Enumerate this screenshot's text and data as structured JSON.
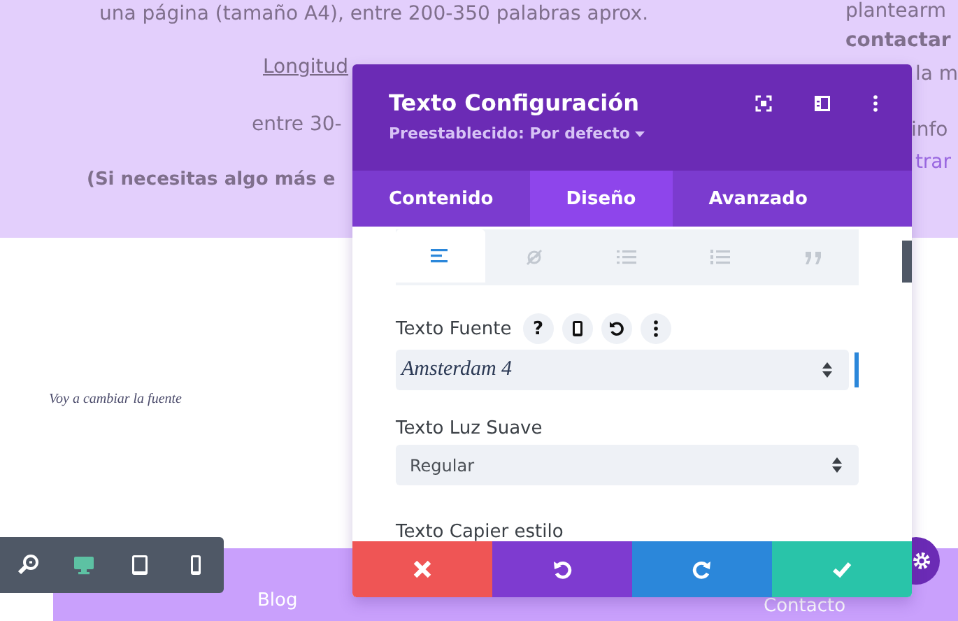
{
  "page": {
    "left_lines": [
      {
        "text": "una página (tamaño A4), entre 200-350 palabras aprox.",
        "kind": "plain"
      },
      {
        "text": "Longitud",
        "kind": "link"
      },
      {
        "text": "entre 30-",
        "kind": "plain"
      },
      {
        "text": "(Si necesitas algo más e",
        "kind": "bold"
      }
    ],
    "right_lines": [
      {
        "text": "plantearm",
        "kind": "plain"
      },
      {
        "text": "contactar",
        "kind": "bold"
      },
      {
        "text": "la m",
        "kind": "plain"
      },
      {
        "text": "info",
        "kind": "plain"
      },
      {
        "text": "trar",
        "kind": "faint"
      }
    ],
    "script_text": "Voy a cambiar la fuente"
  },
  "view_toolbar": [
    {
      "kind": "zoom",
      "selected": false
    },
    {
      "kind": "desktop",
      "selected": true
    },
    {
      "kind": "tablet",
      "selected": false
    },
    {
      "kind": "phone",
      "selected": false
    }
  ],
  "nav": [
    "Blog",
    "Contacto"
  ],
  "modal": {
    "title": "Texto Configuración",
    "preset": "Preestablecido: Por defecto",
    "tabs": [
      {
        "label": "Contenido",
        "selected": false
      },
      {
        "label": "Diseño",
        "selected": true
      },
      {
        "label": "Avanzado",
        "selected": false
      }
    ],
    "format_tabs": [
      {
        "kind": "align",
        "selected": true
      },
      {
        "kind": "link",
        "selected": false
      },
      {
        "kind": "bullets",
        "selected": false
      },
      {
        "kind": "numbers",
        "selected": false
      },
      {
        "kind": "quote",
        "selected": false
      }
    ],
    "fields": [
      {
        "label": "Texto Fuente",
        "kind": "font",
        "value": "Amsterdam 4",
        "tools": [
          {
            "kind": "help",
            "label": "?"
          },
          {
            "kind": "phone"
          },
          {
            "kind": "reset"
          },
          {
            "kind": "more"
          }
        ]
      },
      {
        "label": "Texto Luz Suave",
        "kind": "select",
        "value": "Regular"
      },
      {
        "label": "Texto Capier estilo",
        "kind": "label"
      }
    ],
    "actions": [
      {
        "kind": "cancel"
      },
      {
        "kind": "undo"
      },
      {
        "kind": "redo"
      },
      {
        "kind": "save"
      }
    ]
  }
}
